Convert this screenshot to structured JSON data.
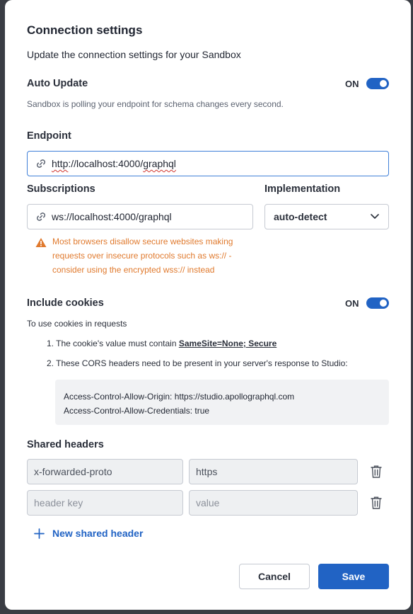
{
  "dialog": {
    "title": "Connection settings",
    "subtitle": "Update the connection settings for your Sandbox"
  },
  "auto_update": {
    "label": "Auto Update",
    "state": "ON",
    "help": "Sandbox is polling your endpoint for schema changes every second."
  },
  "endpoint": {
    "label": "Endpoint",
    "prefix": "http",
    "middle": "://localhost:4000/",
    "suffix": "graphql"
  },
  "subscriptions": {
    "label": "Subscriptions",
    "value": "ws://localhost:4000/graphql",
    "warning": [
      "Most browsers disallow secure websites making",
      "requests over insecure protocols such as ws:// -",
      "consider using the encrypted wss:// instead"
    ]
  },
  "implementation": {
    "label": "Implementation",
    "selected": "auto-detect"
  },
  "cookies": {
    "label": "Include cookies",
    "state": "ON",
    "help": "To use cookies in requests",
    "item1_prefix": "1. The cookie's value must contain ",
    "item1_strong": "SameSite=None; Secure",
    "item2": "2. These CORS headers need to be present in your server's response to Studio:",
    "code_line1": "Access-Control-Allow-Origin: https://studio.apollographql.com",
    "code_line2": "Access-Control-Allow-Credentials: true"
  },
  "shared_headers": {
    "label": "Shared headers",
    "rows": [
      {
        "key": "x-forwarded-proto",
        "value": "https"
      },
      {
        "key_placeholder": "header key",
        "value_placeholder": "value"
      }
    ],
    "add_label": "New shared header"
  },
  "footer": {
    "cancel_label": "Cancel",
    "save_label": "Save"
  },
  "colors": {
    "accent": "#2163c4",
    "warning": "#e07a2e",
    "backdrop": "#3a3d44"
  },
  "icons": [
    "link-icon",
    "warning-icon",
    "chevron-down-icon",
    "trash-icon",
    "plus-icon"
  ]
}
